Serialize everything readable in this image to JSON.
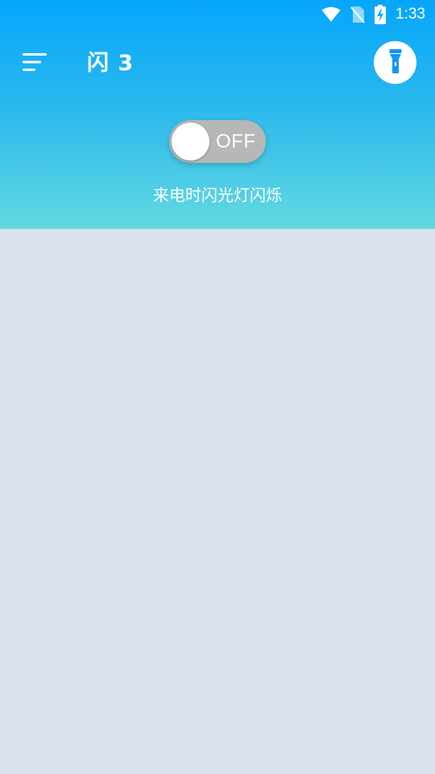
{
  "status_bar": {
    "time": "1:33",
    "icons": [
      "wifi-icon",
      "no-sim-icon",
      "battery-charging-icon"
    ]
  },
  "toolbar": {
    "title": "闪 3",
    "menu_icon": "menu-lines-icon",
    "action_icon": "flashlight-icon"
  },
  "flash_toggle": {
    "state_label": "OFF",
    "is_on": false
  },
  "caption": "来电时闪光灯闪烁",
  "colors": {
    "header_top": "#05a6fb",
    "header_bottom": "#63d9e0",
    "toggle_off": "#b7b7b7",
    "background": "#dbe2ef",
    "flashlight_icon": "#1296f0"
  }
}
